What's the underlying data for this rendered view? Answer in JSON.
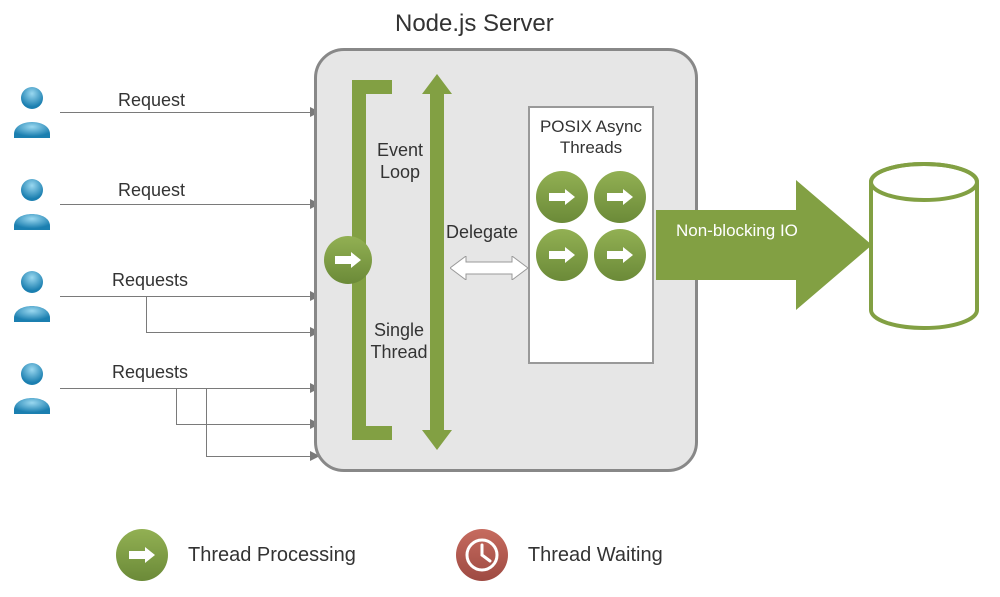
{
  "title": "Node.js Server",
  "requests": [
    "Request",
    "Request",
    "Requests",
    "Requests"
  ],
  "eventLoopLabel": "Event Loop",
  "singleThreadLabel": "Single Thread",
  "delegateLabel": "Delegate",
  "posixTitle": "POSIX Async Threads",
  "nonBlockingLabel": "Non-blocking IO",
  "legend": {
    "processing": "Thread Processing",
    "waiting": "Thread Waiting"
  },
  "colors": {
    "green": "#82a043",
    "greenGrad1": "#92b053",
    "greenGrad2": "#6b8a38",
    "red": "#b85a50",
    "grey": "#e6e6e6",
    "userBlue": "#3aa8d8"
  }
}
